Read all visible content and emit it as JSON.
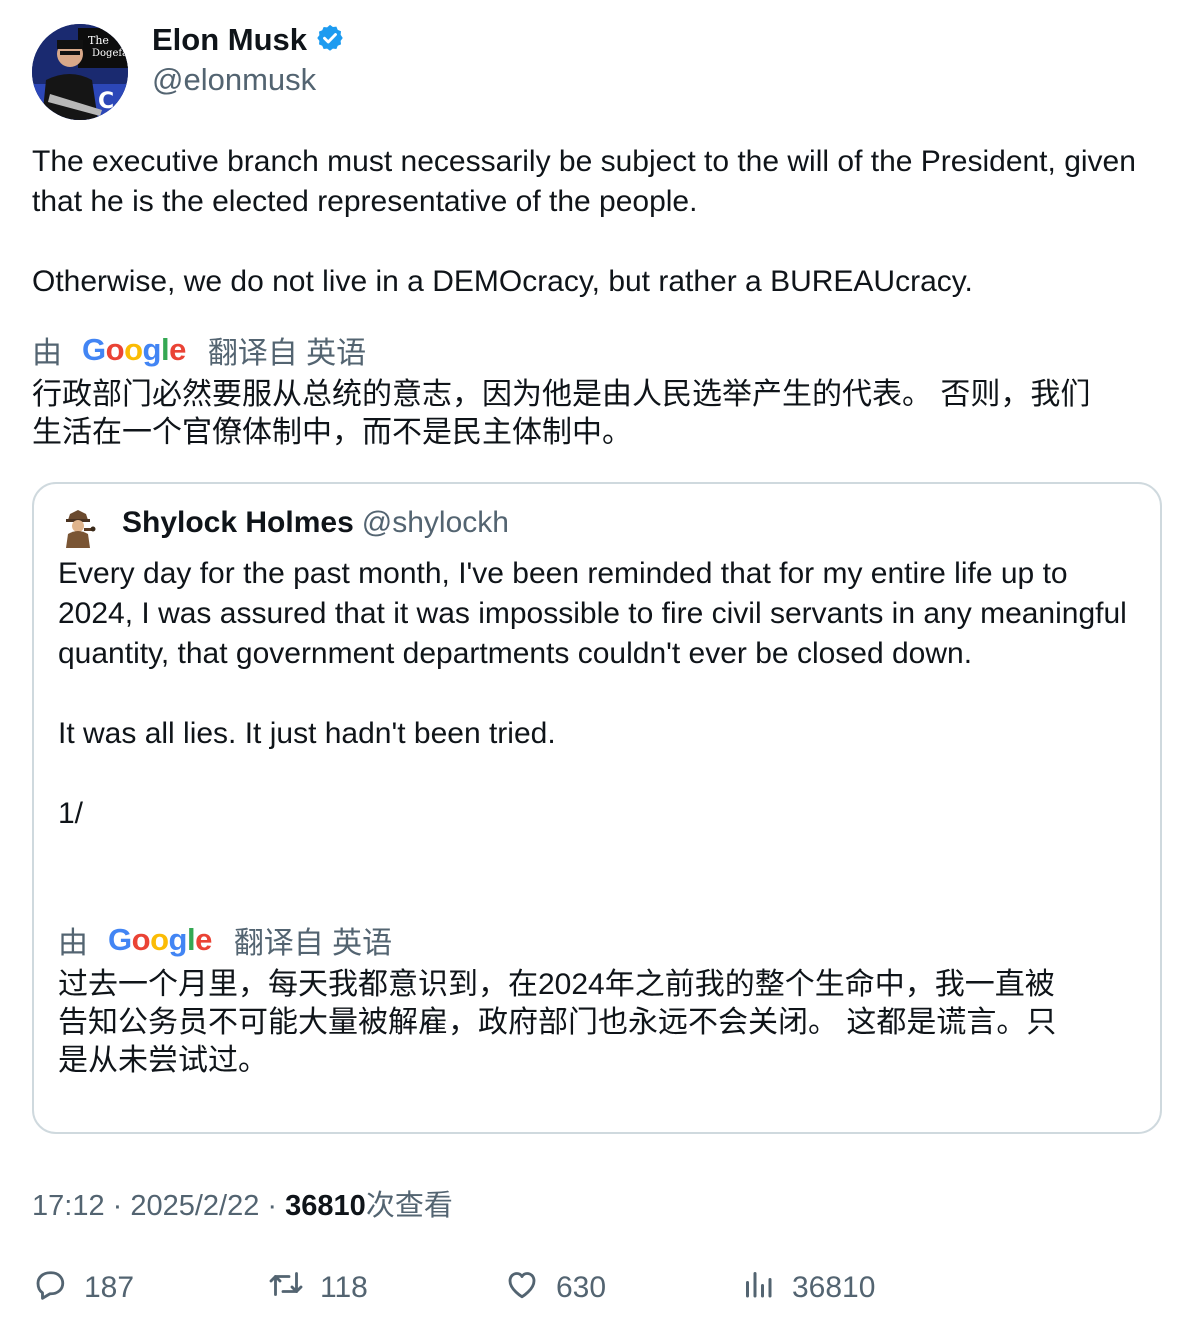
{
  "author": {
    "name": "Elon Musk",
    "handle": "@elonmusk",
    "verified_color": "#1d9bf0"
  },
  "tweet": {
    "text": "The executive branch must necessarily be subject to the will of the President, given that he is the elected representative of the people.\n\nOtherwise, we do not live in a DEMOcracy, but rather a BUREAUcracy.",
    "translate_prefix": "由",
    "translate_brand": "Google",
    "translate_suffix": "翻译自 英语",
    "translated_line1": "行政部门必然要服从总统的意志，因为他是由人民选举产生的代表。 否则，我们",
    "translated_line2": "生活在一个官僚体制中，而不是民主体制中。"
  },
  "quote": {
    "name": "Shylock Holmes",
    "handle": "@shylockh",
    "text": "Every day for the past month, I've been reminded that for my entire life up to 2024, I was assured that it was impossible to fire civil servants in any meaningful quantity, that government departments couldn't ever be closed down.\n\nIt was all lies. It just hadn't been tried.\n\n1/",
    "translate_prefix": "由",
    "translate_brand": "Google",
    "translate_suffix": "翻译自 英语",
    "translated_line1": "过去一个月里，每天我都意识到，在2024年之前我的整个生命中，我一直被",
    "translated_line2": "告知公务员不可能大量被解雇，政府部门也永远不会关闭。 这都是谎言。只",
    "translated_line3": "是从未尝试过。"
  },
  "meta": {
    "time": "17:12",
    "sep1": " · ",
    "date": "2025/2/22",
    "sep2": " · ",
    "views": "36810",
    "views_label": "次查看"
  },
  "actions": {
    "replies": "187",
    "retweets": "118",
    "likes": "630",
    "views": "36810"
  },
  "colors": {
    "google_blue": "#4285f4",
    "google_red": "#ea4335",
    "google_yellow": "#fbbc05",
    "google_green": "#34a853"
  }
}
